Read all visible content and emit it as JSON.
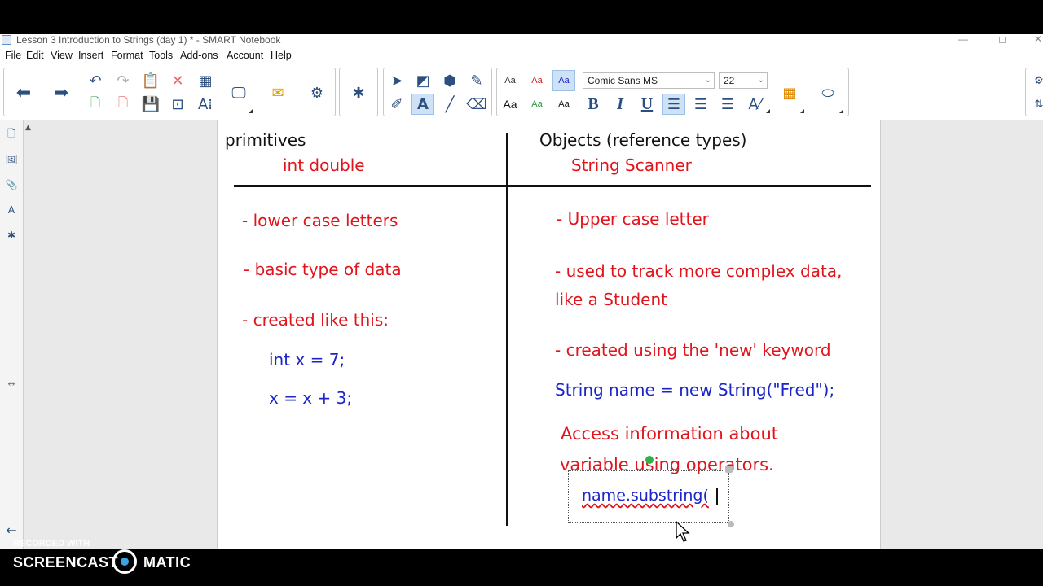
{
  "window": {
    "title": "Lesson 3 Introduction to Strings (day 1) * - SMART Notebook",
    "minimize": "—",
    "maximize": "◻",
    "close": "✕"
  },
  "menu": [
    "File",
    "Edit",
    "View",
    "Insert",
    "Format",
    "Tools",
    "Add-ons",
    "Account",
    "Help"
  ],
  "toolbar": {
    "font_name": "Comic Sans MS",
    "font_size": "22",
    "text_style_labels": [
      "Aa",
      "Aa",
      "Aa",
      "Aa",
      "Aa",
      "Aa"
    ],
    "bold": "B",
    "italic": "I",
    "underline": "U",
    "accent": "#cfe1f5"
  },
  "board": {
    "left_header": "primitives",
    "left_types": "int  double",
    "right_header": "Objects (reference types)",
    "right_types": "String    Scanner",
    "left_items": [
      "-  lower case letters",
      "-  basic type of data",
      "-  created like this:"
    ],
    "left_code": [
      "int x = 7;",
      "x = x + 3;"
    ],
    "right_items": [
      "- Upper case letter",
      "-  used to track more complex data,",
      "like a Student",
      "- created using the 'new' keyword"
    ],
    "right_code": "String name = new String(\"Fred\");",
    "access_line1": "Access information about",
    "access_line2": "variable using  operators.",
    "editing_text": "name.substring(",
    "colors": {
      "black": "#111111",
      "red": "#e2141b",
      "blue": "#1b25c8"
    }
  },
  "watermark": {
    "recorded_with": "RECORDED WITH",
    "brand_left": "SCREENCAST",
    "brand_right": "MATIC"
  }
}
